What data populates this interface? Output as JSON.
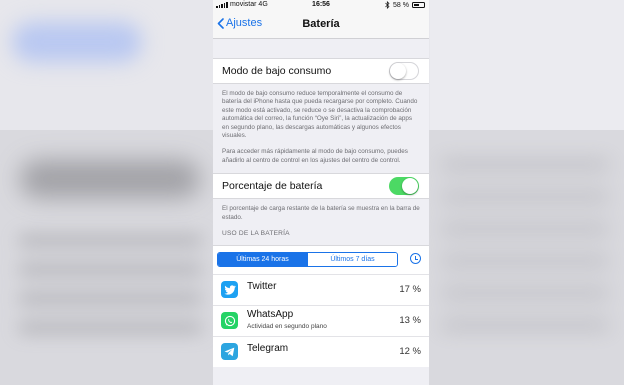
{
  "status_bar": {
    "carrier": "movistar",
    "network": "4G",
    "time": "16:56",
    "battery_percent": "58 %",
    "battery_level": 0.58
  },
  "nav": {
    "back_label": "Ajustes",
    "title": "Batería"
  },
  "low_power": {
    "label": "Modo de bajo consumo",
    "enabled": false,
    "description": "El modo de bajo consumo reduce temporalmente el consumo de batería del iPhone hasta que pueda recargarse por completo. Cuando este modo está activado, se reduce o se desactiva la comprobación automática del correo, la función “Oye Siri”, la actualización de apps en segundo plano, las descargas automáticas y algunos efectos visuales.",
    "description2": "Para acceder más rápidamente al modo de bajo consumo, puedes añadirlo al centro de control en los ajustes del centro de control."
  },
  "battery_percentage": {
    "label": "Porcentaje de batería",
    "enabled": true,
    "description": "El porcentaje de carga restante de la batería se muestra en la barra de estado."
  },
  "usage": {
    "section_header": "USO DE LA BATERÍA",
    "tabs": [
      {
        "label": "Últimas 24 horas",
        "active": true
      },
      {
        "label": "Últimos 7 días",
        "active": false
      }
    ],
    "apps": [
      {
        "name": "Twitter",
        "subtitle": "",
        "percent": "17 %",
        "icon": "twitter-bird-icon",
        "color": "#1da1f2"
      },
      {
        "name": "WhatsApp",
        "subtitle": "Actividad en segundo plano",
        "percent": "13 %",
        "icon": "whatsapp-phone-icon",
        "color": "#25d366"
      },
      {
        "name": "Telegram",
        "subtitle": "",
        "percent": "12 %",
        "icon": "telegram-plane-icon",
        "color": "#2ca5e0"
      }
    ]
  },
  "colors": {
    "accent": "#1a73e8",
    "toggle_on": "#4cd964"
  }
}
